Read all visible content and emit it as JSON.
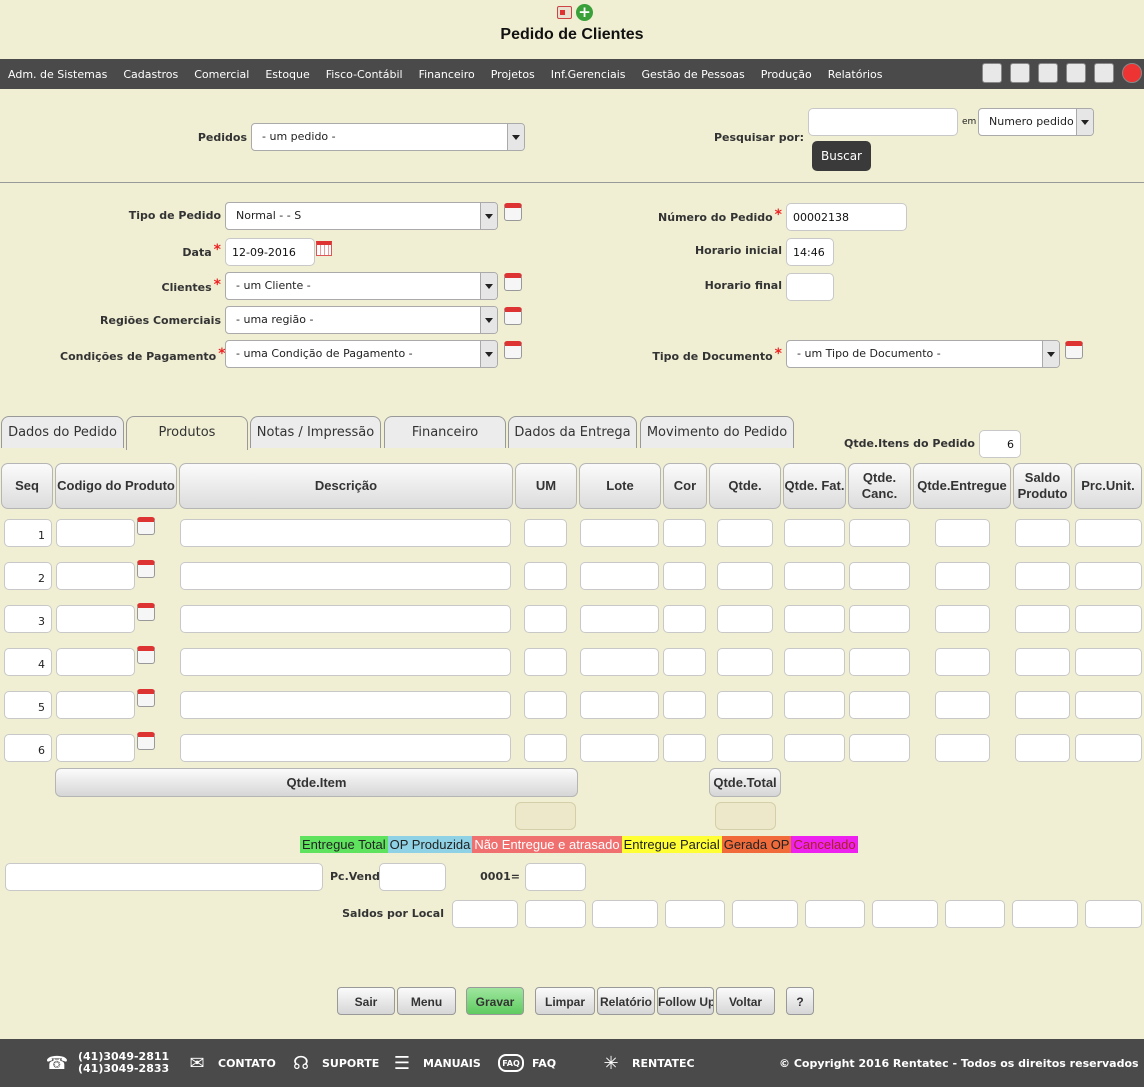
{
  "page": {
    "title": "Pedido de Clientes"
  },
  "menu": [
    "Adm. de Sistemas",
    "Cadastros",
    "Comercial",
    "Estoque",
    "Fisco-Contábil",
    "Financeiro",
    "Projetos",
    "Inf.Gerenciais",
    "Gestão de Pessoas",
    "Produção",
    "Relatórios"
  ],
  "menu_icons": [
    "home-icon",
    "save-icon",
    "new-doc-icon",
    "list-icon",
    "help-icon",
    "exit-icon"
  ],
  "search": {
    "pedidos_label": "Pedidos",
    "pedidos_value": "- um pedido -",
    "pesquisar_label": "Pesquisar por:",
    "em_label": "em",
    "em_value": "Numero pedido",
    "buscar_label": "Buscar",
    "query": ""
  },
  "form": {
    "tipo_pedido_label": "Tipo de Pedido",
    "tipo_pedido_value": "Normal - - S",
    "data_label": "Data",
    "data_value": "12-09-2016",
    "clientes_label": "Clientes",
    "clientes_value": "- um Cliente -",
    "regioes_label": "Regiões Comerciais",
    "regioes_value": "- uma região -",
    "condicoes_label": "Condições de Pagamento",
    "condicoes_value": "- uma Condição de Pagamento -",
    "numero_label": "Número do Pedido",
    "numero_value": "00002138",
    "horario_inicial_label": "Horario inicial",
    "horario_inicial_value": "14:46",
    "horario_final_label": "Horario final",
    "horario_final_value": "",
    "tipo_doc_label": "Tipo de Documento",
    "tipo_doc_value": "- um Tipo de Documento -"
  },
  "tabs": [
    "Dados do Pedido",
    "Produtos",
    "Notas / Impressão",
    "Financeiro",
    "Dados da Entrega",
    "Movimento do Pedido"
  ],
  "active_tab": "Produtos",
  "qtde_itens": {
    "label": "Qtde.Itens do Pedido",
    "value": "6"
  },
  "table": {
    "columns": [
      "Seq",
      "Codigo do Produto",
      "Descrição",
      "UM",
      "Lote",
      "Cor",
      "Qtde.",
      "Qtde. Fat.",
      "Qtde. Canc.",
      "Qtde.Entregue",
      "Saldo Produto",
      "Prc.Unit."
    ],
    "rows": [
      "1",
      "2",
      "3",
      "4",
      "5",
      "6"
    ]
  },
  "totals": {
    "qtde_item_label": "Qtde.Item",
    "qtde_total_label": "Qtde.Total"
  },
  "legend": [
    {
      "label": "Entregue Total",
      "color": "#5fe35f"
    },
    {
      "label": "OP Produzida",
      "color": "#8fd2e6"
    },
    {
      "label": "Não Entregue e atrasado",
      "color": "#f07070"
    },
    {
      "label": "Entregue Parcial",
      "color": "#ffff33"
    },
    {
      "label": "Gerada OP",
      "color": "#f06a3a"
    },
    {
      "label": "Cancelado",
      "color": "#ee22ee"
    }
  ],
  "lower": {
    "pc_venda_label": "Pc.Venda",
    "code_label": "0001=",
    "saldos_label": "Saldos por Local"
  },
  "buttons": {
    "sair": "Sair",
    "menu": "Menu",
    "gravar": "Gravar",
    "limpar": "Limpar",
    "relatorio": "Relatório",
    "followup": "Follow Up",
    "voltar": "Voltar",
    "help": "?"
  },
  "footer": {
    "phone1": "(41)3049-2811",
    "phone2": "(41)3049-2833",
    "contato": "CONTATO",
    "suporte": "SUPORTE",
    "manuais": "MANUAIS",
    "faq": "FAQ",
    "faq_icon_text": "FAQ",
    "rentatec": "RENTATEC",
    "copyright": "© Copyright 2016 Rentatec - Todos os direitos reservados"
  }
}
